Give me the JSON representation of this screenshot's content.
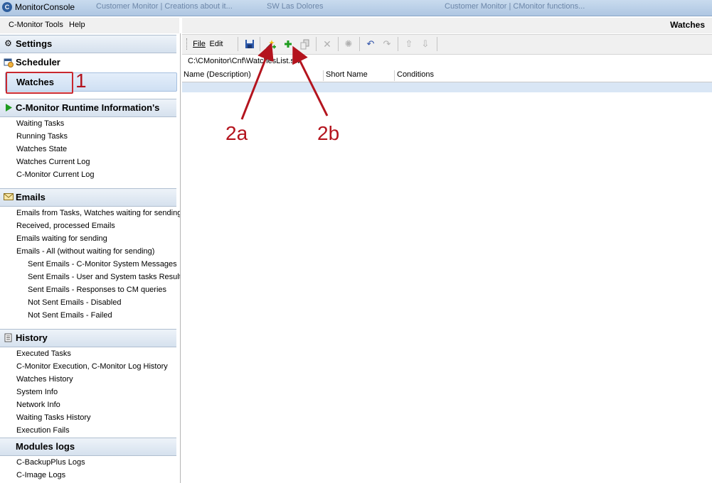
{
  "window": {
    "title": "MonitorConsole",
    "background_titles": [
      "Customer Monitor | Creations about it...",
      "SW Las Dolores",
      "Customer Monitor | CMonitor functions..."
    ]
  },
  "menubar": {
    "items": [
      "C-Monitor Tools",
      "Help"
    ]
  },
  "sidebar": {
    "settings_label": "Settings",
    "scheduler_label": "Scheduler",
    "watches_label": "Watches",
    "runtime": {
      "header": "C-Monitor Runtime Information's",
      "items": [
        "Waiting Tasks",
        "Running Tasks",
        "Watches State",
        "Watches Current Log",
        "C-Monitor Current Log"
      ]
    },
    "emails": {
      "header": "Emails",
      "items": [
        "Emails from Tasks, Watches waiting for sending",
        "Received, processed Emails",
        "Emails waiting for sending",
        "Emails - All (without waiting for sending)"
      ],
      "subitems": [
        "Sent Emails - C-Monitor System Messages",
        "Sent Emails - User and System tasks Results",
        "Sent Emails - Responses to CM queries",
        "Not Sent Emails - Disabled",
        "Not Sent Emails - Failed"
      ]
    },
    "history": {
      "header": "History",
      "items": [
        "Executed Tasks",
        "C-Monitor Execution, C-Monitor Log History",
        "Watches History",
        "System Info",
        "Network Info",
        "Waiting Tasks History",
        "Execution Fails"
      ]
    },
    "modules": {
      "header": "Modules logs",
      "items": [
        "C-BackupPlus Logs",
        "C-Image Logs"
      ]
    }
  },
  "content": {
    "title": "Watches",
    "toolbar": {
      "file_label": "File",
      "edit_label": "Edit",
      "icons": [
        "save-icon",
        "add-watch-wizard-icon",
        "add-icon",
        "copy-icon",
        "delete-icon",
        "settings-icon",
        "undo-icon",
        "redo-icon",
        "move-up-icon",
        "move-down-icon"
      ]
    },
    "path": "C:\\CMonitor\\Cnf\\WatchesList.sw",
    "columns": [
      "Name (Description)",
      "Short Name",
      "Conditions"
    ]
  },
  "annotations": {
    "label_1": "1",
    "label_2a": "2a",
    "label_2b": "2b",
    "color": "#b4141e"
  }
}
